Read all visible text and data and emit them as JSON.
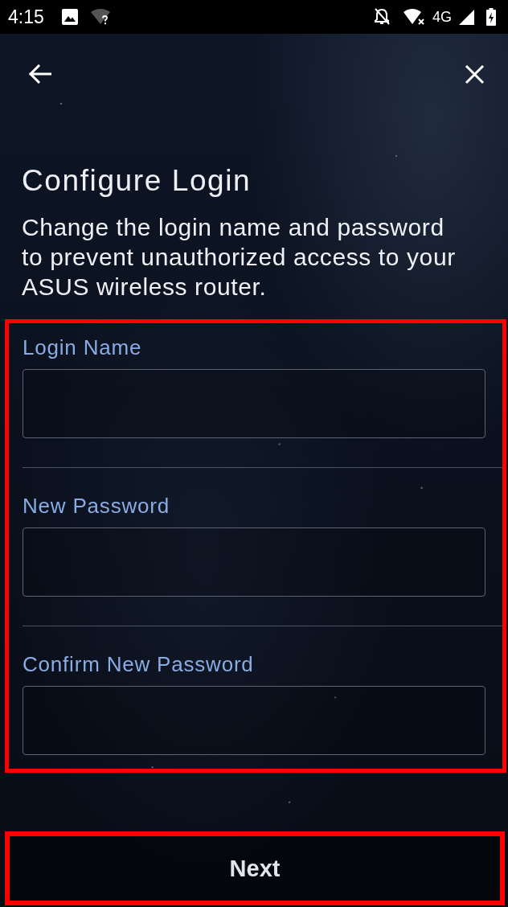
{
  "status_bar": {
    "time": "4:15",
    "network_type": "4G"
  },
  "header": {
    "title": "Configure Login",
    "description": "Change the login name and password to prevent unauthorized access to your ASUS wireless router."
  },
  "form": {
    "highlighted": true,
    "fields": [
      {
        "label": "Login Name"
      },
      {
        "label": "New Password"
      },
      {
        "label": "Confirm New Password"
      }
    ]
  },
  "next_button": {
    "label": "Next",
    "highlighted": true
  }
}
